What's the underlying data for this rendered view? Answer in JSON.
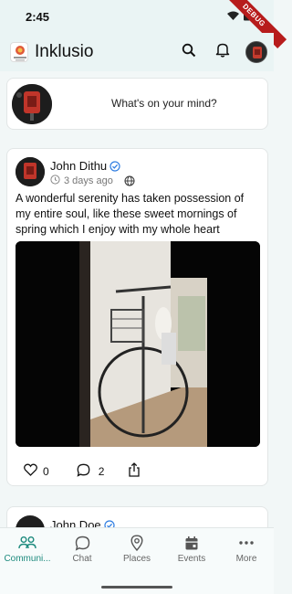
{
  "status_bar": {
    "time": "2:45",
    "debug_label": "DEBUG"
  },
  "app_bar": {
    "title": "Inklusio",
    "icons": [
      "search-icon",
      "bell-icon"
    ]
  },
  "composer": {
    "prompt": "What's on your mind?"
  },
  "post": {
    "author": "John Dithu",
    "verified": true,
    "time": "3 days ago",
    "visibility_icon": "globe-icon",
    "text": "A wonderful serenity has taken possession of my entire soul, like these sweet mornings of spring which I enjoy with my whole heart",
    "likes": "0",
    "comments": "2"
  },
  "next_post": {
    "author": "John Doe",
    "verified": true
  },
  "bottom_nav": {
    "items": [
      {
        "label": "Communi...",
        "icon": "community-icon",
        "active": true
      },
      {
        "label": "Chat",
        "icon": "chat-icon",
        "active": false
      },
      {
        "label": "Places",
        "icon": "location-pin-icon",
        "active": false
      },
      {
        "label": "Events",
        "icon": "calendar-icon",
        "active": false
      },
      {
        "label": "More",
        "icon": "more-dots-icon",
        "active": false
      }
    ]
  },
  "colors": {
    "accent": "#1d8a7d",
    "verified": "#2f7de1",
    "appbar_bg": "#eaf4f4"
  }
}
